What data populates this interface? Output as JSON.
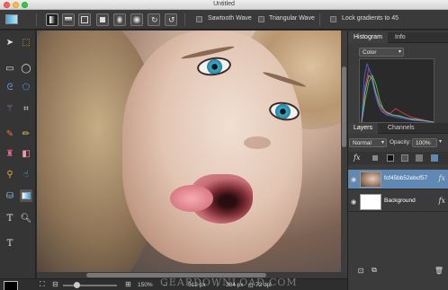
{
  "window": {
    "title": "Untitled"
  },
  "options_bar": {
    "sawtooth_label": "Sawtooth Wave",
    "triangular_label": "Triangular Wave",
    "lock_label": "Lock gradients to 45"
  },
  "status": {
    "zoom": "150%",
    "width": "512 px",
    "height": "384 px",
    "resolution": "72 dpi"
  },
  "watermark": "GEARDOWNLOAD.COM",
  "panels": {
    "tabs_top": [
      "Histogram",
      "Info"
    ],
    "histogram_mode": "Color",
    "tabs_layers": [
      "Layers",
      "Channels"
    ],
    "blend_mode": "Normal",
    "opacity_label": "Opacity:",
    "opacity_value": "100%",
    "fx": "fx",
    "layers": [
      {
        "name": "fcf45bb52ebcf57",
        "selected": true
      },
      {
        "name": "Background",
        "selected": false
      }
    ]
  },
  "colors": {
    "accent_selection": "#5f88b3",
    "foreground": "#000000",
    "background": "#ffffff"
  }
}
